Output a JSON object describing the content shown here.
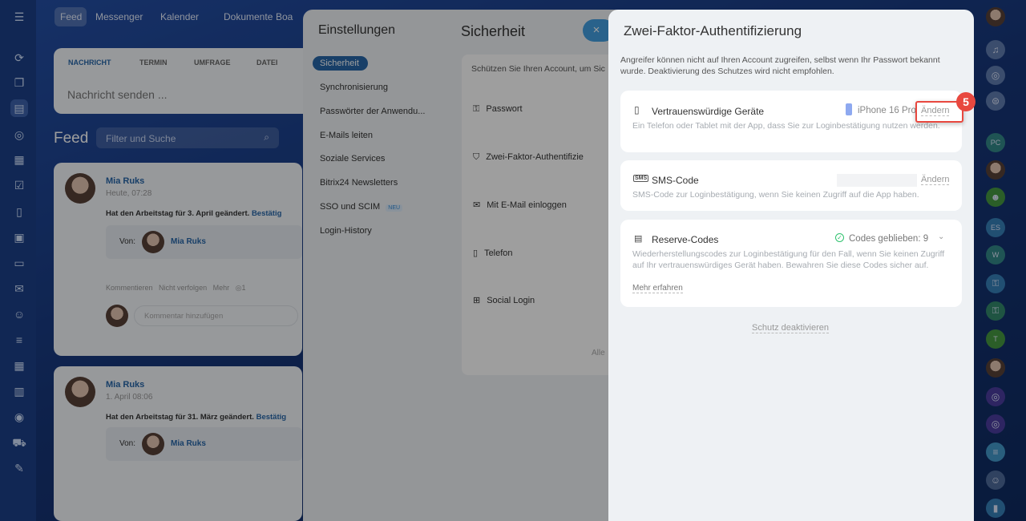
{
  "topnav": {
    "items": [
      "Feed",
      "Messenger",
      "Kalender",
      "Dokumente",
      "Boa"
    ]
  },
  "composer": {
    "tabs": [
      "NACHRICHT",
      "TERMIN",
      "UMFRAGE",
      "DATEI"
    ],
    "placeholder": "Nachricht senden ..."
  },
  "feed": {
    "title": "Feed",
    "filter_placeholder": "Filter und Suche",
    "posts": [
      {
        "author": "Mia Ruks",
        "time": "Heute, 07:28",
        "text": "Hat den Arbeitstag für 3. April geändert.",
        "link": "Bestätig",
        "from_label": "Von:",
        "from": "Mia Ruks",
        "actions": [
          "Kommentieren",
          "Nicht verfolgen",
          "Mehr",
          "1"
        ],
        "comment_placeholder": "Kommentar hinzufügen"
      },
      {
        "author": "Mia Ruks",
        "time": "1. April 08:06",
        "text": "Hat den Arbeitstag für 31. März geändert.",
        "link": "Bestätig",
        "from_label": "Von:",
        "from": "Mia Ruks"
      }
    ]
  },
  "settings": {
    "title": "Einstellungen",
    "nav": [
      "Sicherheit",
      "Synchronisierung",
      "Passwörter der Anwendu...",
      "E-Mails leiten",
      "Soziale Services",
      "Bitrix24 Newsletters",
      "SSO und SCIM",
      "Login-History"
    ],
    "new_badge": "NEU",
    "section_title": "Sicherheit",
    "intro": "Schützen Sie Ihren Account, um Sic",
    "items": [
      "Passwort",
      "Zwei-Faktor-Authentifizie",
      "Mit E-Mail einloggen",
      "Telefon",
      "Social Login"
    ],
    "more": "Alle",
    "close": "×"
  },
  "tfa": {
    "title": "Zwei-Faktor-Authentifizierung",
    "description": "Angreifer können nicht auf Ihren Account zugreifen, selbst wenn Ihr Passwort bekannt wurde. Deaktivierung des Schutzes wird nicht empfohlen.",
    "devices": {
      "title": "Vertrauenswürdige Geräte",
      "device": "iPhone 16 Pro",
      "action": "Ändern",
      "description": "Ein Telefon oder Tablet mit der App, dass Sie zur Loginbestätigung nutzen werden."
    },
    "sms": {
      "title": "SMS-Code",
      "action": "Ändern",
      "description": "SMS-Code zur Loginbestätigung, wenn Sie keinen Zugriff auf die App haben."
    },
    "reserve": {
      "title": "Reserve-Codes",
      "status": "Codes geblieben: 9",
      "description": "Wiederherstellungscodes zur Loginbestätigung für den Fall, wenn Sie keinen Zugriff auf Ihr vertrauenswürdiges Gerät haben. Bewahren Sie diese Codes sicher auf.",
      "link": "Mehr erfahren"
    },
    "deactivate": "Schutz deaktivieren"
  },
  "annotation": {
    "step": "5"
  },
  "right_sidebar": {
    "chats": [
      "PC",
      "ES",
      "W",
      "T"
    ]
  },
  "colors": {
    "accent": "#2067b0",
    "highlight": "#e8483f",
    "success": "#2fc26e"
  }
}
